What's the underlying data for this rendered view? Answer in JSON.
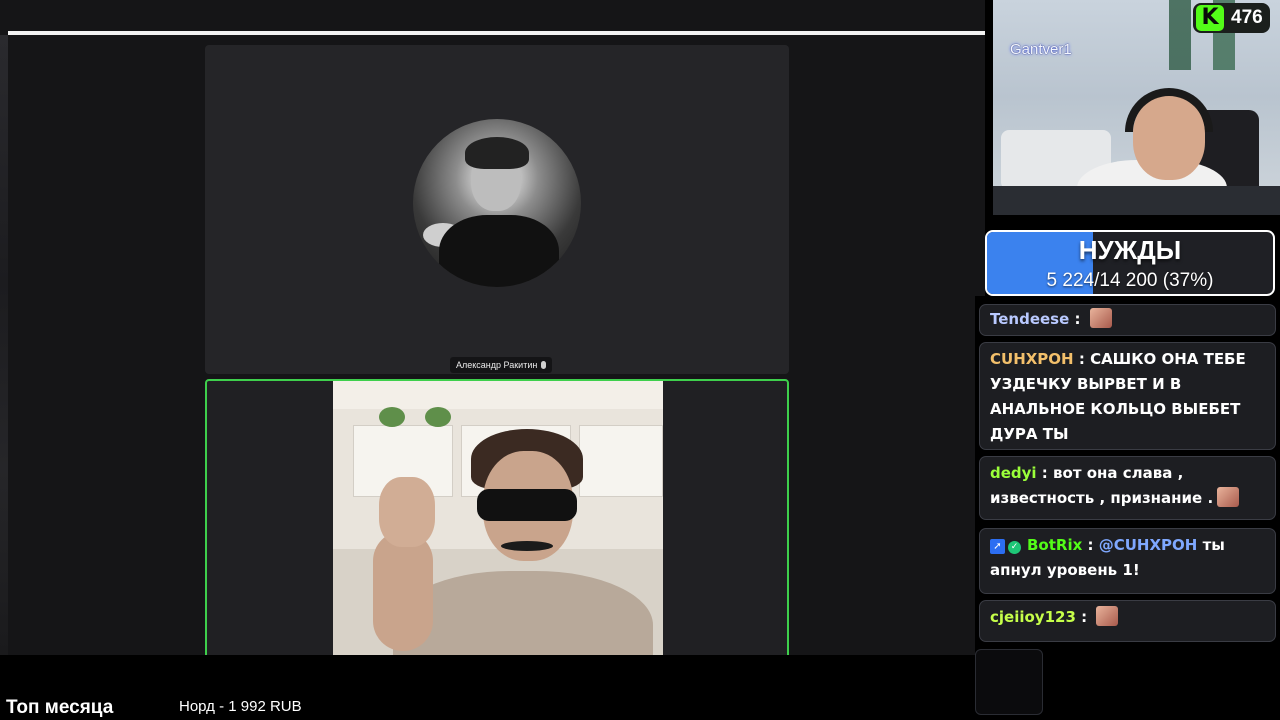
{
  "call": {
    "participant_name": "Александр Ракитин"
  },
  "webcam": {
    "streamer_name": "Gantver1",
    "viewer_count": "476",
    "platform_logo": "K",
    "platform_color": "#53fc18"
  },
  "goal": {
    "title": "НУЖДЫ",
    "progress_text": "5 224/14 200 (37%)",
    "progress_fraction": 0.37,
    "fill_color": "#3b82ee"
  },
  "chat": {
    "messages": [
      {
        "user": "Tendeese",
        "user_color": "#b9c9ff",
        "separator": " : ",
        "text": ""
      },
      {
        "user": "СUНХРОН",
        "user_color": "#f3c06b",
        "separator": " : ",
        "text": "САШКО ОНА ТЕБЕ УЗДЕЧКУ ВЫРВЕТ И В АНАЛЬНОЕ КОЛЬЦО ВЫЕБЕТ ДУРА ТЫ"
      },
      {
        "user": "dedyi",
        "user_color": "#9bff3a",
        "separator": " : ",
        "text": "вот она слава , известность , признание ."
      },
      {
        "user": "BotRix",
        "user_color": "#53fc18",
        "separator": " : ",
        "mention": "@СUНХРОН",
        "text": " ты апнул уровень 1!"
      },
      {
        "user": "cjeiioy123",
        "user_color": "#c6ff4a",
        "separator": " : ",
        "text": ""
      }
    ]
  },
  "ticker": {
    "title": "Топ месяца",
    "entry": "Норд - 1 992 RUB"
  }
}
